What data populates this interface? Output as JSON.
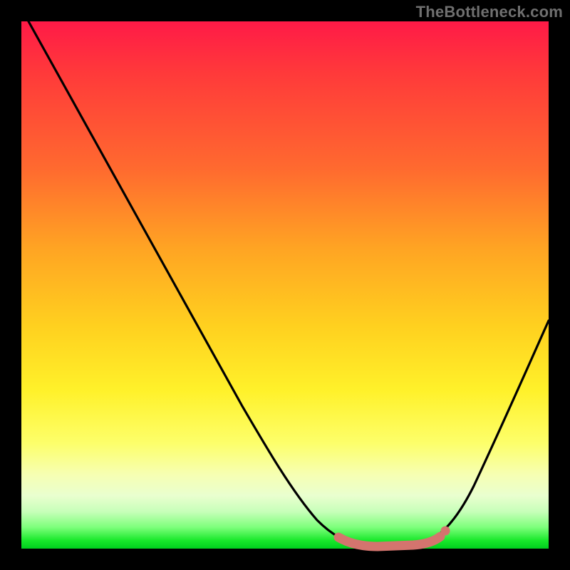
{
  "watermark": {
    "text": "TheBottleneck.com"
  },
  "chart_data": {
    "type": "line",
    "title": "",
    "xlabel": "",
    "ylabel": "",
    "xlim": [
      0,
      100
    ],
    "ylim": [
      0,
      100
    ],
    "grid": false,
    "legend": false,
    "series": [
      {
        "name": "bottleneck-curve",
        "color": "#000000",
        "x": [
          0,
          5,
          10,
          15,
          20,
          25,
          30,
          35,
          40,
          45,
          50,
          55,
          58,
          62,
          66,
          70,
          74,
          78,
          82,
          86,
          90,
          94,
          98,
          100
        ],
        "values": [
          100,
          94,
          87,
          80,
          73,
          66,
          59,
          52,
          45,
          38,
          30,
          20,
          12,
          6,
          2,
          0.5,
          0.5,
          1.5,
          5,
          11,
          20,
          31,
          44,
          51
        ]
      }
    ],
    "optimum_band": {
      "description": "flat bottom segment near optimum",
      "x_start": 62,
      "x_end": 80,
      "color": "#d4746e"
    },
    "background_gradient": {
      "stops": [
        {
          "pct": 0,
          "color": "#ff1a47"
        },
        {
          "pct": 50,
          "color": "#ffd11f"
        },
        {
          "pct": 85,
          "color": "#f6ffb3"
        },
        {
          "pct": 100,
          "color": "#00cf1f"
        }
      ]
    }
  }
}
